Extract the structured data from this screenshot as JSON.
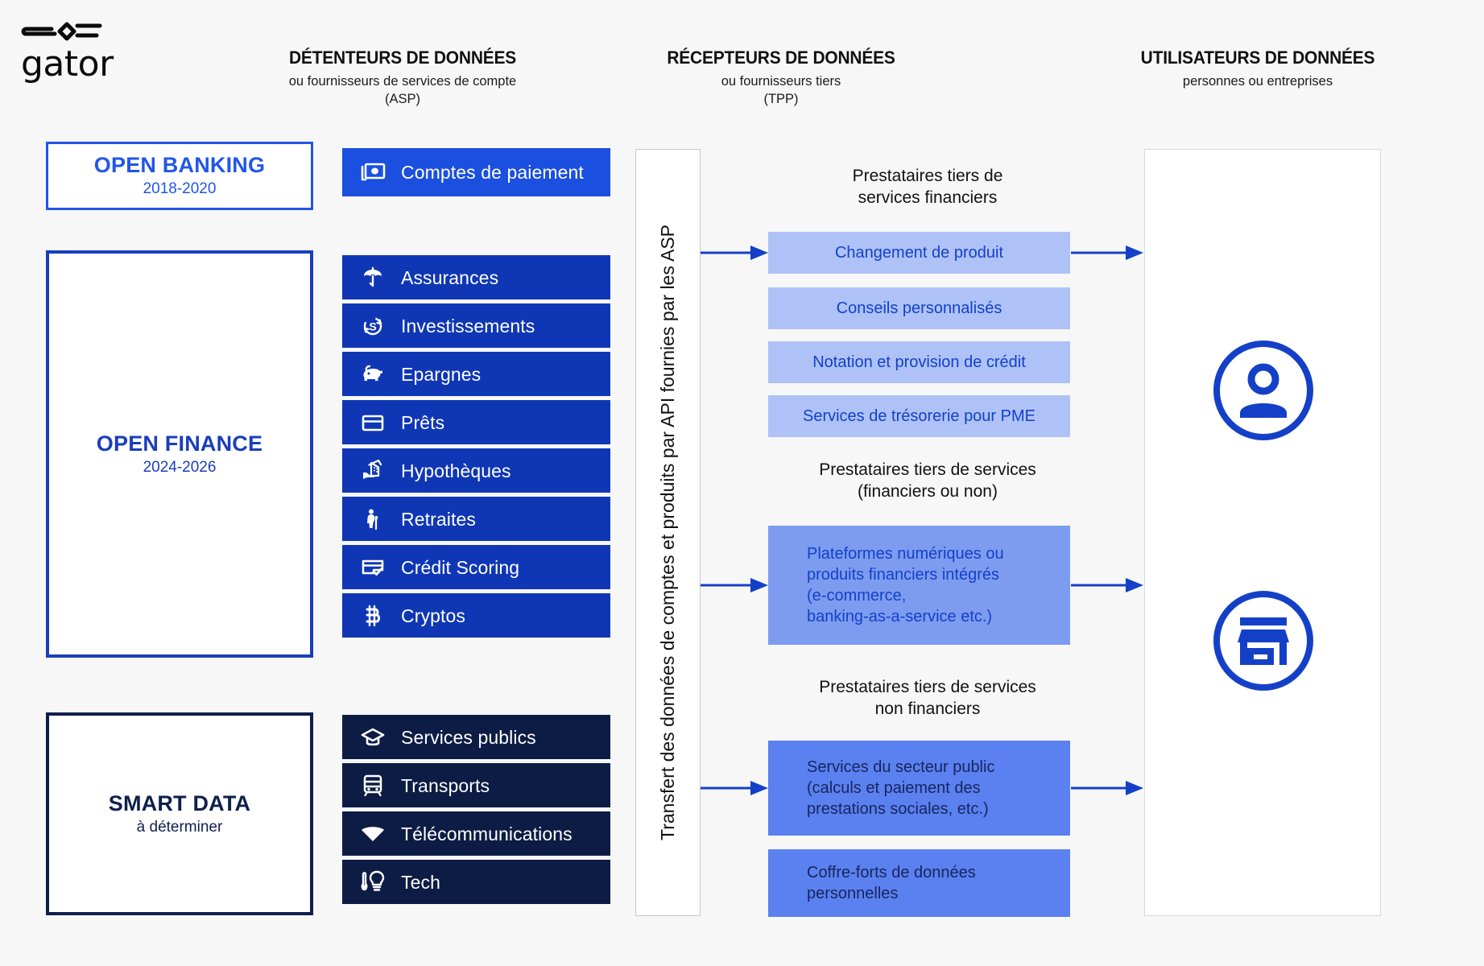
{
  "brand": {
    "name": "gator",
    "logo_icon": "gator-logo-mark"
  },
  "colors": {
    "background": "#f7f7f7",
    "accent_blue": "#1b47e0",
    "royal_blue": "#1440c8",
    "open_banking_blue": "#2156e8",
    "open_finance_blue": "#1a3ebb",
    "smart_data_navy": "#0f1f4d",
    "row_bright": "#1a4fe0",
    "row_medium": "#0f37b5",
    "row_navy": "#0d1c44",
    "box_light": "#aec2f7",
    "box_mid": "#7d9cf0",
    "box_strong": "#5b80f0",
    "arrow": "#1440c8"
  },
  "headers": [
    {
      "title": "DÉTENTEURS DE DONNÉES",
      "sub1": "ou fournisseurs de services de compte",
      "sub2": "(ASP)"
    },
    {
      "title": "RÉCEPTEURS DE DONNÉES",
      "sub1": "ou fournisseurs tiers",
      "sub2": "(TPP)"
    },
    {
      "title": "UTILISATEURS DE DONNÉES",
      "sub1": "personnes ou entreprises",
      "sub2": ""
    }
  ],
  "phases": [
    {
      "title": "OPEN BANKING",
      "period": "2018-2020"
    },
    {
      "title": "OPEN FINANCE",
      "period": "2024-2026"
    },
    {
      "title": "SMART DATA",
      "period": "à déterminer"
    }
  ],
  "data_holders": {
    "open_banking": [
      {
        "label": "Comptes de paiement",
        "icon": "banknotes-icon"
      }
    ],
    "open_finance": [
      {
        "label": "Assurances",
        "icon": "umbrella-icon"
      },
      {
        "label": "Investissements",
        "icon": "dollar-refresh-icon"
      },
      {
        "label": "Epargnes",
        "icon": "piggy-bank-icon"
      },
      {
        "label": "Prêts",
        "icon": "credit-card-icon"
      },
      {
        "label": "Hypothèques",
        "icon": "hand-house-icon"
      },
      {
        "label": "Retraites",
        "icon": "elderly-person-icon"
      },
      {
        "label": "Crédit Scoring",
        "icon": "card-check-icon"
      },
      {
        "label": "Cryptos",
        "icon": "bitcoin-icon"
      }
    ],
    "smart_data": [
      {
        "label": "Services publics",
        "icon": "graduation-cap-icon"
      },
      {
        "label": "Transports",
        "icon": "tram-icon"
      },
      {
        "label": "Télécommunications",
        "icon": "wifi-icon"
      },
      {
        "label": "Tech",
        "icon": "thermometer-bulb-icon"
      }
    ]
  },
  "transfer_band": {
    "text": "Transfert des données de comptes et produits par API fournies par les ASP"
  },
  "receivers": [
    {
      "title_line1": "Prestataires tiers de",
      "title_line2": "services financiers",
      "items": [
        {
          "lines": [
            "Changement de produit"
          ],
          "align": "center",
          "tone": "light"
        },
        {
          "lines": [
            "Conseils personnalisés"
          ],
          "align": "center",
          "tone": "light"
        },
        {
          "lines": [
            "Notation et provision de crédit"
          ],
          "align": "center",
          "tone": "light"
        },
        {
          "lines": [
            "Services de trésorerie pour PME"
          ],
          "align": "center",
          "tone": "light"
        }
      ]
    },
    {
      "title_line1": "Prestataires tiers de services",
      "title_line2": "(financiers ou non)",
      "items": [
        {
          "lines": [
            "Plateformes numériques ou",
            "produits financiers intégrés",
            "(e-commerce,",
            "banking-as-a-service etc.)"
          ],
          "align": "left",
          "tone": "mid"
        }
      ]
    },
    {
      "title_line1": "Prestataires tiers de services",
      "title_line2": "non financiers",
      "items": [
        {
          "lines": [
            "Services du secteur public",
            "(calculs et paiement des",
            "prestations sociales, etc.)"
          ],
          "align": "left",
          "tone": "strong"
        },
        {
          "lines": [
            "Coffre-forts de données",
            "personnelles"
          ],
          "align": "left",
          "tone": "strong"
        }
      ]
    }
  ],
  "users": [
    {
      "icon": "person-circle-icon"
    },
    {
      "icon": "store-circle-icon"
    }
  ],
  "arrows": [
    {
      "from": "transfer-band",
      "to": "receiver-group-1"
    },
    {
      "from": "transfer-band",
      "to": "receiver-group-2"
    },
    {
      "from": "transfer-band",
      "to": "receiver-group-3"
    },
    {
      "from": "receiver-group-1",
      "to": "users-panel"
    },
    {
      "from": "receiver-group-2",
      "to": "users-panel"
    },
    {
      "from": "receiver-group-3",
      "to": "users-panel"
    }
  ]
}
